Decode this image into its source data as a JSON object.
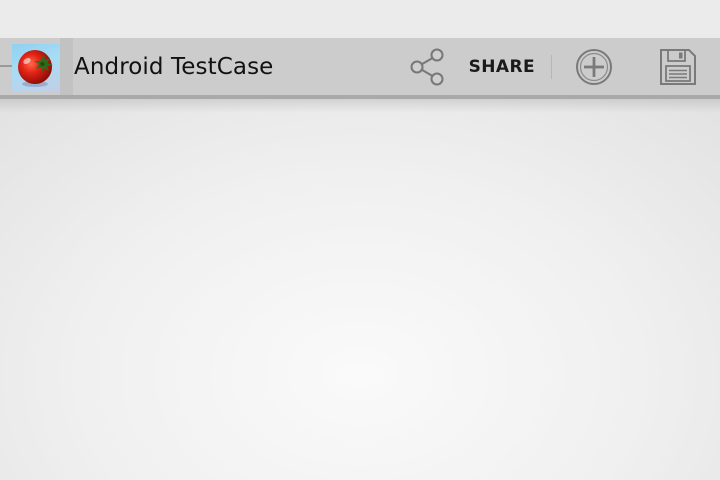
{
  "action_bar": {
    "title": "Android TestCase",
    "share_label": "SHARE"
  },
  "icons": {
    "app": "tomato-icon",
    "share": "share-icon",
    "add": "add-circle-icon",
    "save": "floppy-disk-icon"
  },
  "colors": {
    "action_bar_background": "#cccccc",
    "content_background": "#f3f3f3"
  }
}
